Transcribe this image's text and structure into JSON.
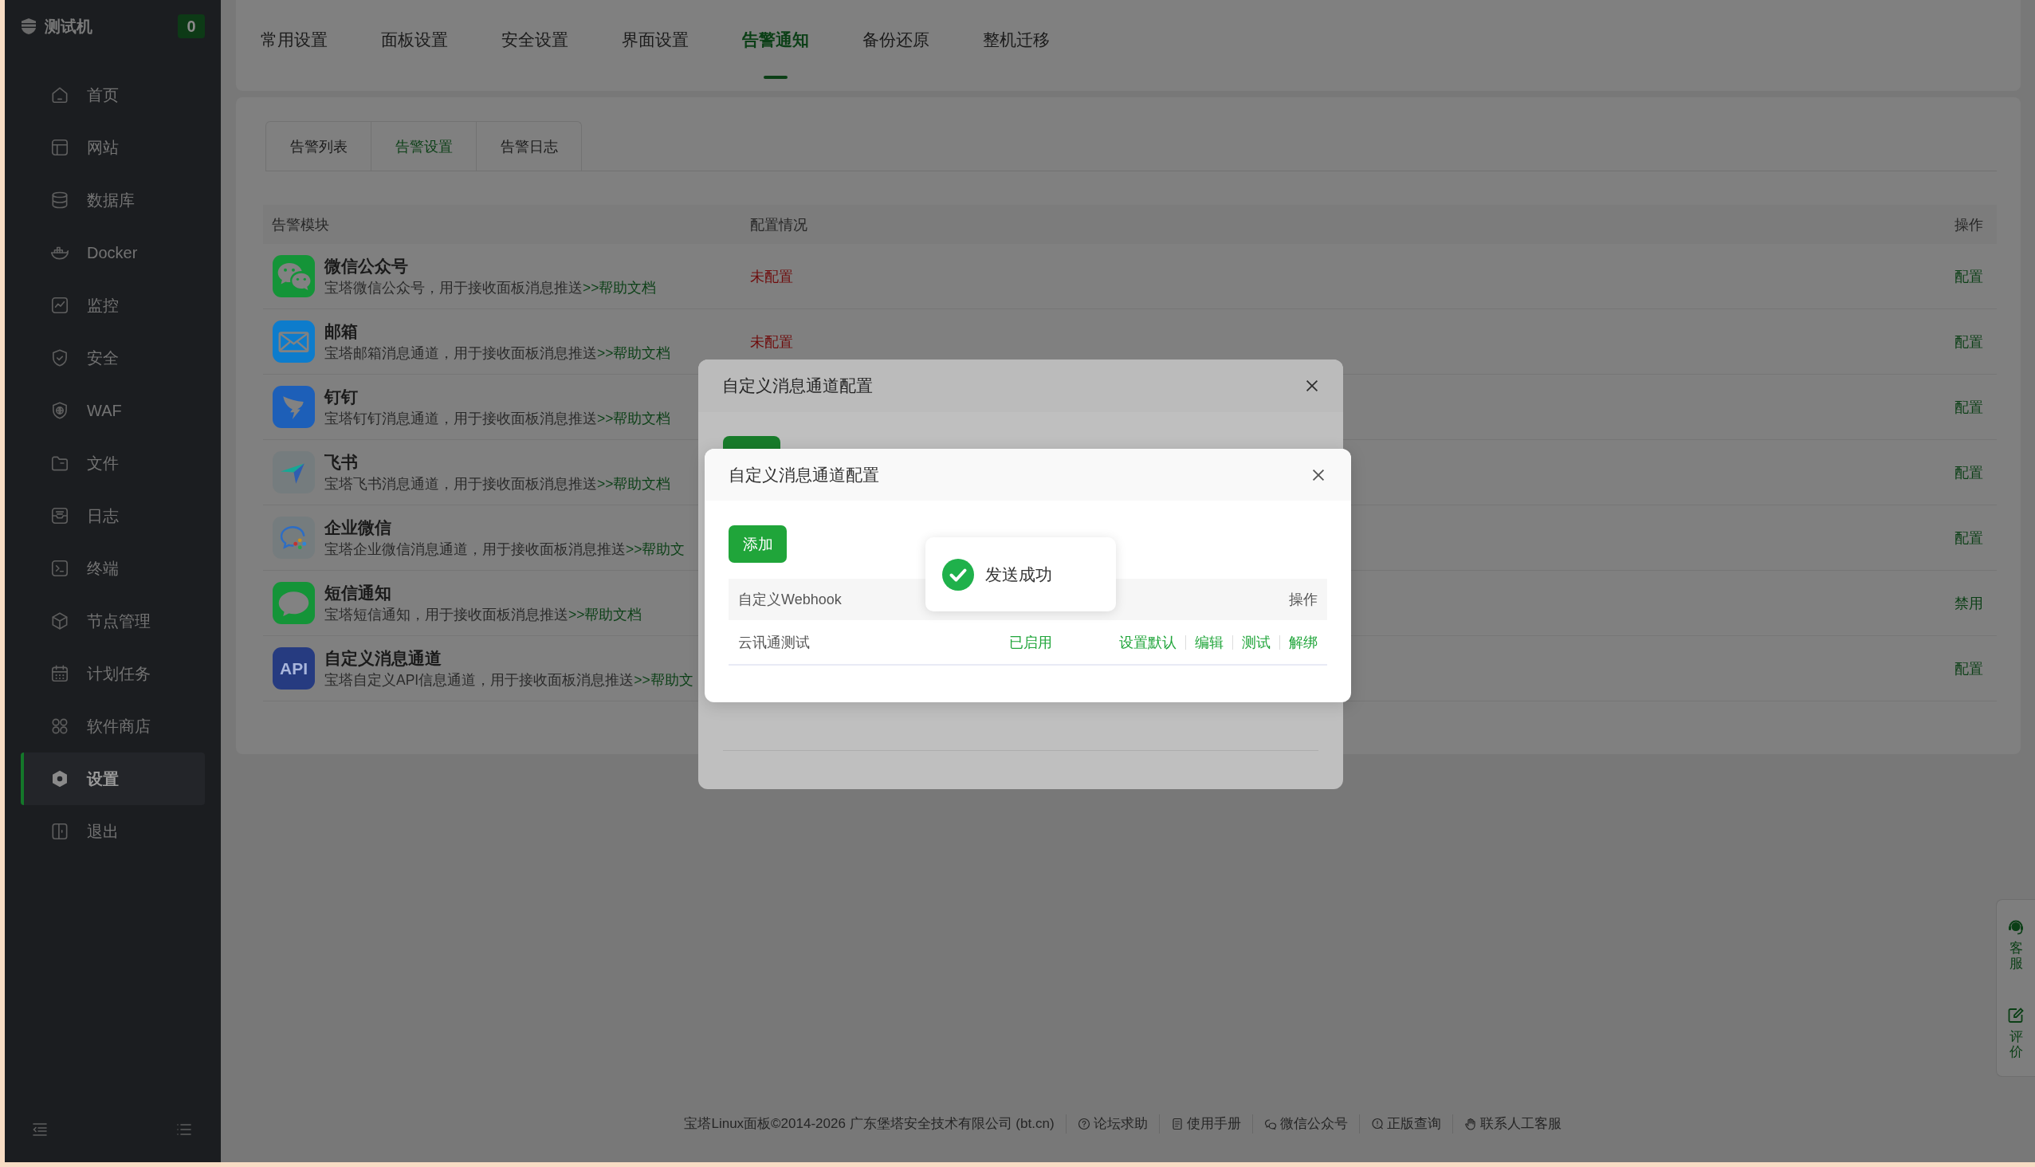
{
  "sidebar": {
    "title": "测试机",
    "badge": "0",
    "items": [
      {
        "label": "首页",
        "selected": false
      },
      {
        "label": "网站",
        "selected": false
      },
      {
        "label": "数据库",
        "selected": false
      },
      {
        "label": "Docker",
        "selected": false
      },
      {
        "label": "监控",
        "selected": false
      },
      {
        "label": "安全",
        "selected": false
      },
      {
        "label": "WAF",
        "selected": false
      },
      {
        "label": "文件",
        "selected": false
      },
      {
        "label": "日志",
        "selected": false
      },
      {
        "label": "终端",
        "selected": false
      },
      {
        "label": "节点管理",
        "selected": false
      },
      {
        "label": "计划任务",
        "selected": false
      },
      {
        "label": "软件商店",
        "selected": false
      },
      {
        "label": "设置",
        "selected": true
      },
      {
        "label": "退出",
        "selected": false
      }
    ]
  },
  "tabs": [
    {
      "label": "常用设置",
      "selected": false
    },
    {
      "label": "面板设置",
      "selected": false
    },
    {
      "label": "安全设置",
      "selected": false
    },
    {
      "label": "界面设置",
      "selected": false
    },
    {
      "label": "告警通知",
      "selected": true
    },
    {
      "label": "备份还原",
      "selected": false
    },
    {
      "label": "整机迁移",
      "selected": false
    }
  ],
  "subtabs": [
    {
      "label": "告警列表",
      "selected": false
    },
    {
      "label": "告警设置",
      "selected": true
    },
    {
      "label": "告警日志",
      "selected": false
    }
  ],
  "table": {
    "columns": [
      "告警模块",
      "配置情况",
      "操作"
    ],
    "rows": [
      {
        "title": "微信公众号",
        "description": "宝塔微信公众号，用于接收面板消息推送",
        "link": ">>帮助文档",
        "status": "未配置",
        "action": "配置"
      },
      {
        "title": "邮箱",
        "description": "宝塔邮箱消息通道，用于接收面板消息推送",
        "link": ">>帮助文档",
        "status": "未配置",
        "action": "配置"
      },
      {
        "title": "钉钉",
        "description": "宝塔钉钉消息通道，用于接收面板消息推送",
        "link": ">>帮助文档",
        "action": "配置"
      },
      {
        "title": "飞书",
        "description": "宝塔飞书消息通道，用于接收面板消息推送",
        "link": ">>帮助文档",
        "action": "配置"
      },
      {
        "title": "企业微信",
        "description": "宝塔企业微信消息通道，用于接收面板消息推送",
        "link": ">>帮助文",
        "action": "配置"
      },
      {
        "title": "短信通知",
        "description": "宝塔短信通知，用于接收面板消息推送",
        "link": ">>帮助文档",
        "action": "禁用"
      },
      {
        "title": "自定义消息通道",
        "icon_text": "API",
        "description": "宝塔自定义API信息通道，用于接收面板消息推送",
        "link": ">>帮助文",
        "action": "配置"
      }
    ]
  },
  "back_dialog": {
    "title": "自定义消息通道配置"
  },
  "dialog": {
    "title": "自定义消息通道配置",
    "add_button": "添加",
    "table": {
      "columns": [
        "自定义Webhook",
        "操作"
      ],
      "rows": [
        {
          "name": "云讯通测试",
          "status": "已启用",
          "actions": [
            "设置默认",
            "编辑",
            "测试",
            "解绑"
          ]
        }
      ]
    }
  },
  "toast": {
    "message": "发送成功"
  },
  "side_toolbar": [
    {
      "label": "客服"
    },
    {
      "label": "评价"
    }
  ],
  "footer": {
    "copyright": "宝塔Linux面板©2014-2026 广东堡塔安全技术有限公司 (bt.cn)",
    "links": [
      "论坛求助",
      "使用手册",
      "微信公众号",
      "正版查询",
      "联系人工客服"
    ]
  }
}
